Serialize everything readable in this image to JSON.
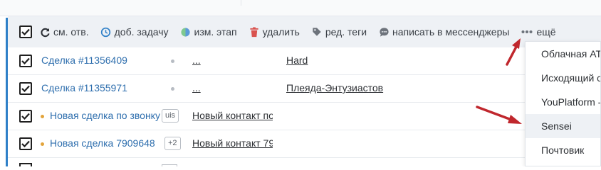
{
  "toolbar": {
    "items": [
      {
        "label": "см. отв.",
        "icon": "refresh-icon"
      },
      {
        "label": "доб. задачу",
        "icon": "clock-icon"
      },
      {
        "label": "изм. этап",
        "icon": "stage-icon"
      },
      {
        "label": "удалить",
        "icon": "trash-icon"
      },
      {
        "label": "ред. теги",
        "icon": "tag-icon"
      },
      {
        "label": "написать в мессенджеры",
        "icon": "chat-icon"
      },
      {
        "label": "ещё",
        "icon": "more-dots-icon"
      }
    ]
  },
  "rows": [
    {
      "lead": "Сделка #11356409",
      "contact": "...",
      "company": "Hard",
      "checked": true
    },
    {
      "lead": "Сделка #11355971",
      "contact": "...",
      "company": "Плеяда-Энтузиастов",
      "checked": true
    },
    {
      "lead": "Новая сделка по звонку",
      "tag": "uis",
      "contact": "Новый контакт по звонку",
      "company": "",
      "checked": true
    },
    {
      "lead": "Новая сделка 7909648",
      "tag": "+2",
      "contact": "Новый контакт 79",
      "company": "",
      "checked": true
    }
  ],
  "dropdown": {
    "items": [
      "Облачная АТС",
      "Исходящий с",
      "YouPlatform -",
      "Sensei",
      "Почтовик"
    ],
    "highlighted_index": 3
  },
  "colors": {
    "accent": "#2f80c8",
    "link": "#2f6fae",
    "annotation_arrow": "#c0272d",
    "delete_icon": "#d9534f"
  }
}
